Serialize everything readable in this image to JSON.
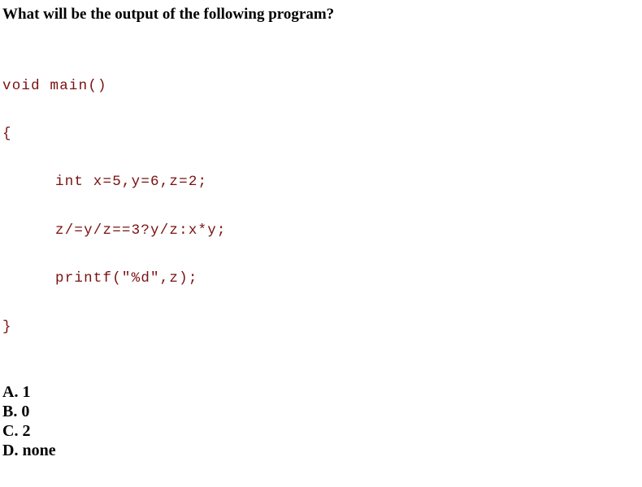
{
  "question": "What will be the output of the following program?",
  "code": {
    "lines": [
      "void main()",
      "{",
      "int x=5,y=6,z=2;",
      "z/=y/z==3?y/z:x*y;",
      "printf(\"%d\",z);",
      "}"
    ],
    "color": "#7a1010"
  },
  "options": [
    "A. 1",
    "B. 0",
    "C. 2",
    "D. none"
  ]
}
